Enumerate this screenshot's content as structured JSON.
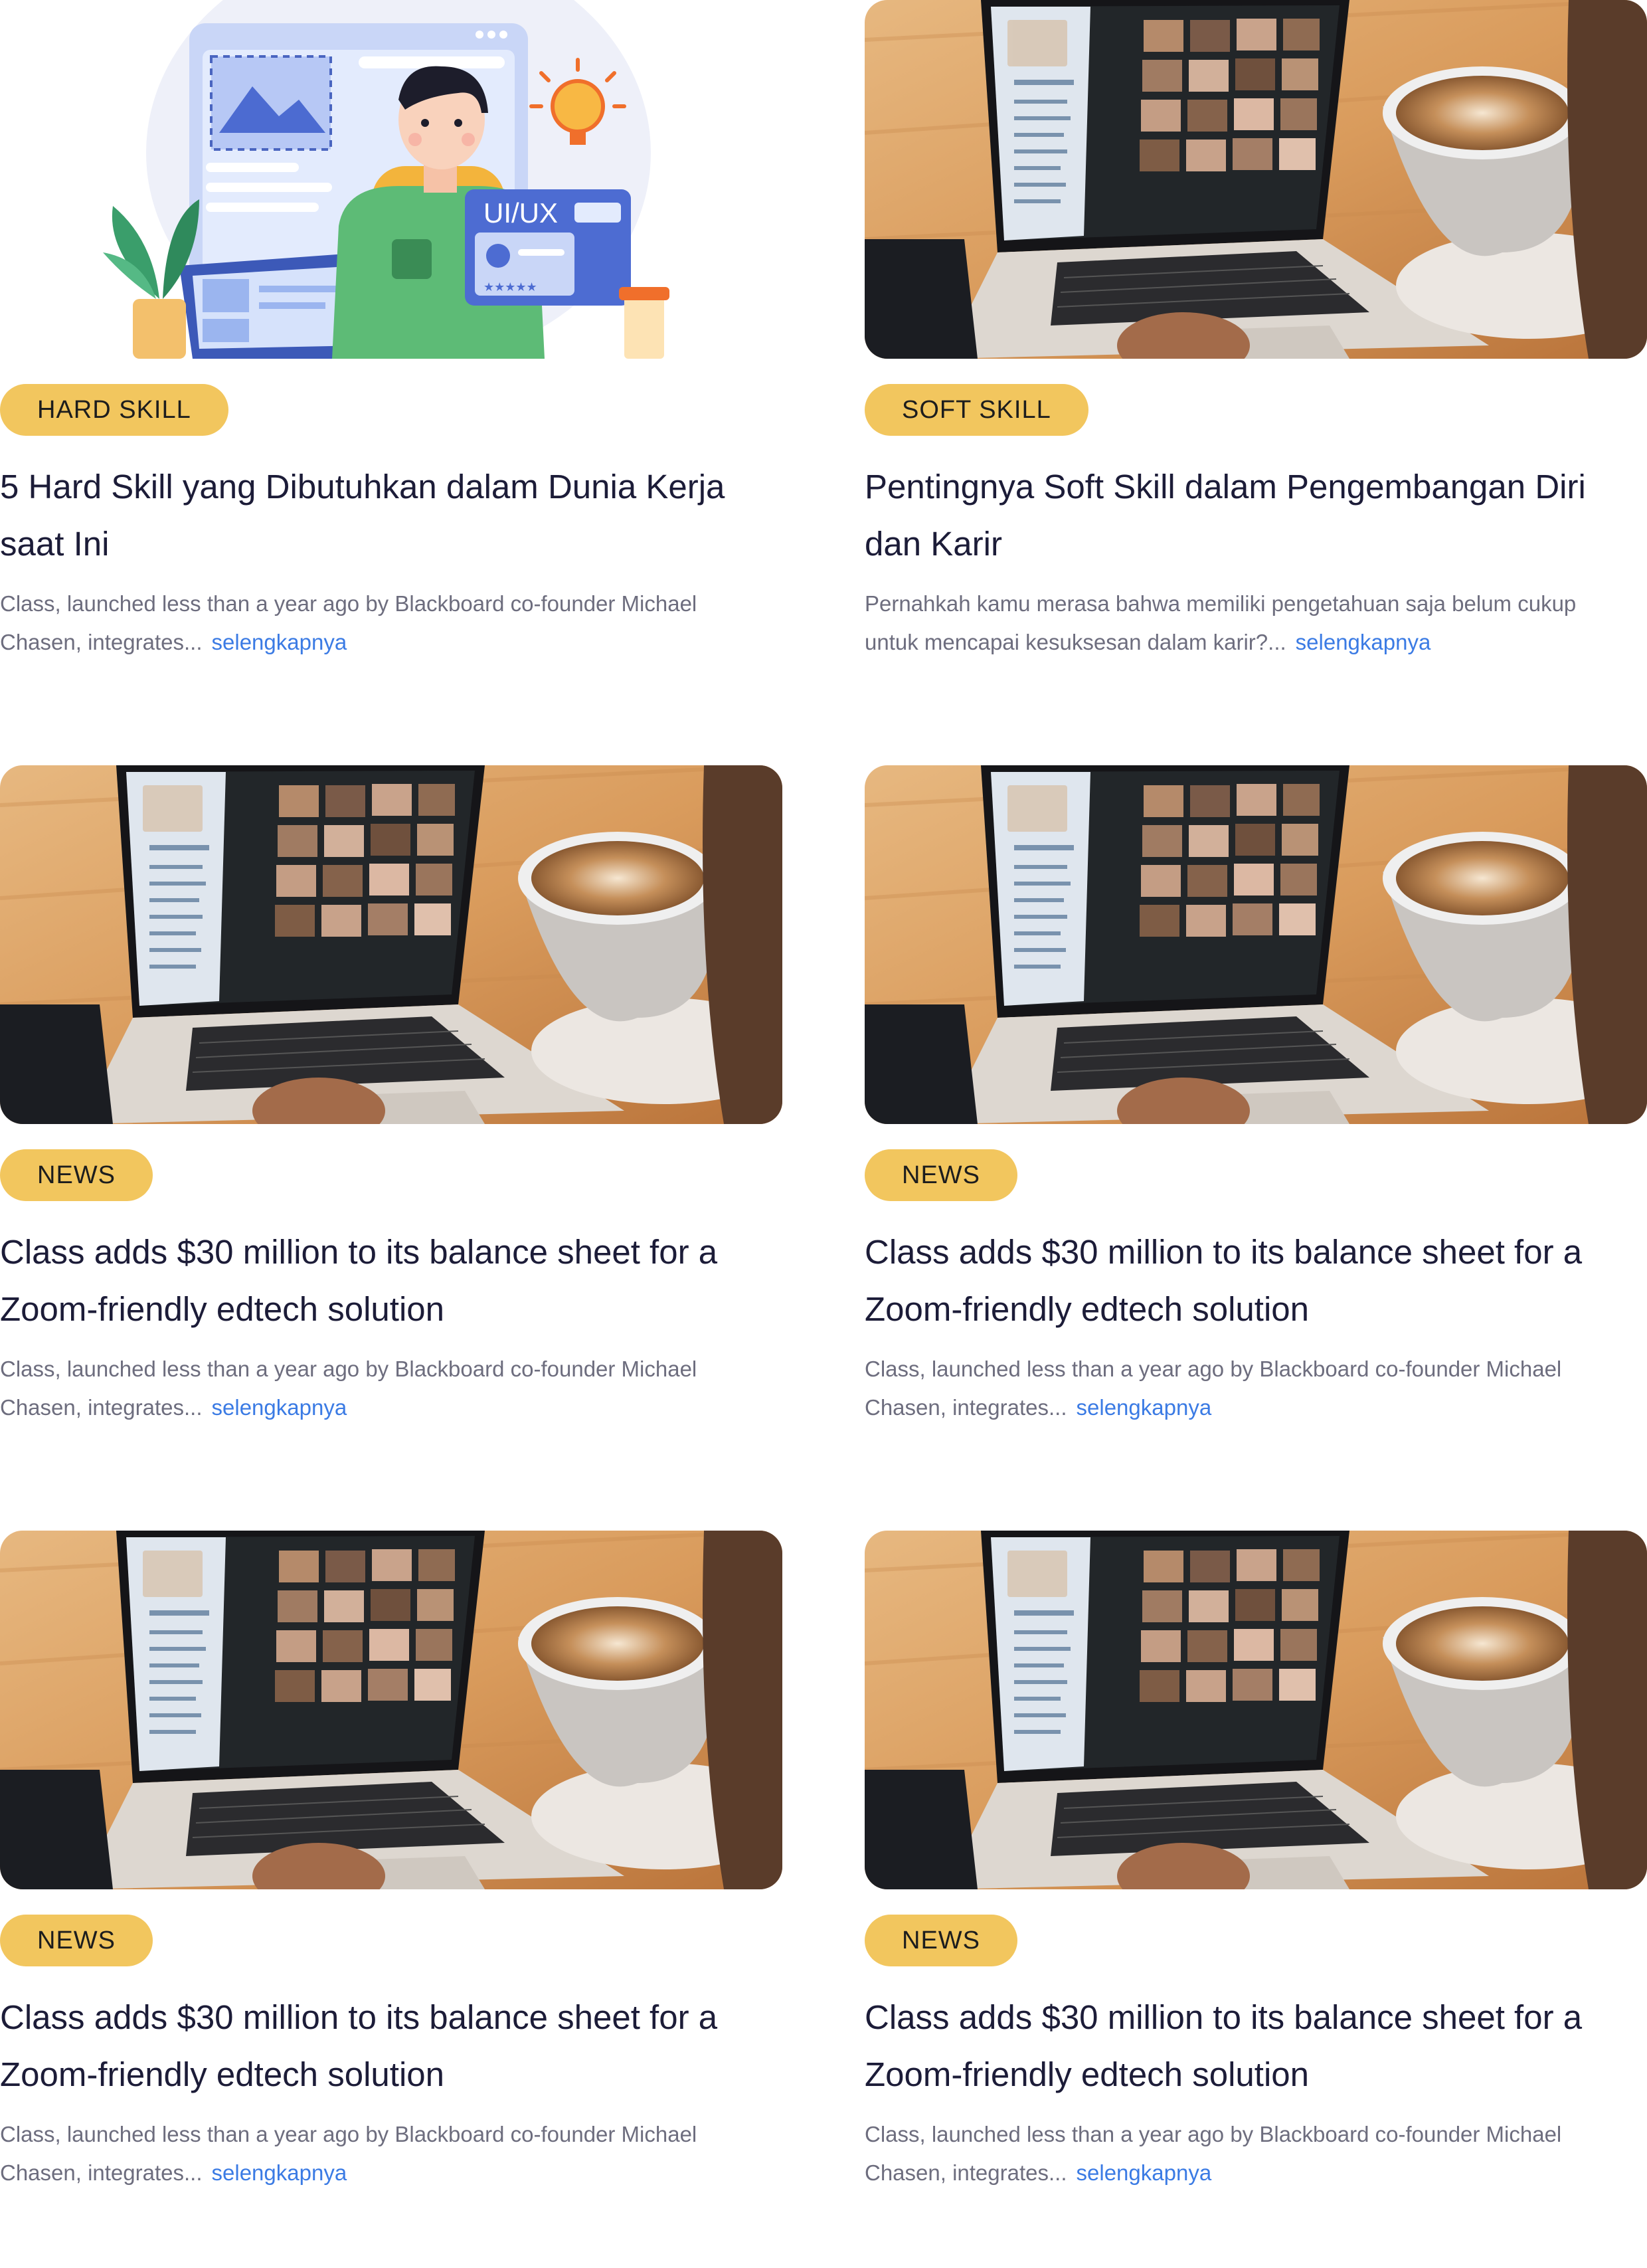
{
  "articles": [
    {
      "image": "illustration-uiux-designer",
      "category": "HARD SKILL",
      "title": "5 Hard Skill yang Dibutuhkan dalam Dunia Kerja saat Ini",
      "excerpt": "Class, launched less than a year ago by Blackboard co-founder Michael Chasen, integrates...",
      "read_more": "selengkapnya"
    },
    {
      "image": "photo-laptop-video-call",
      "category": "SOFT SKILL",
      "title": "Pentingnya Soft Skill dalam Pengembangan Diri dan Karir",
      "excerpt": "Pernahkah kamu merasa bahwa memiliki pengetahuan saja belum cukup untuk mencapai kesuksesan dalam karir?...",
      "read_more": "selengkapnya"
    },
    {
      "image": "photo-laptop-video-call",
      "category": "NEWS",
      "title": "Class adds $30 million to its balance sheet for a Zoom-friendly edtech solution",
      "excerpt": "Class, launched less than a year ago by Blackboard co-founder Michael Chasen, integrates...",
      "read_more": "selengkapnya"
    },
    {
      "image": "photo-laptop-video-call",
      "category": "NEWS",
      "title": "Class adds $30 million to its balance sheet for a Zoom-friendly edtech solution",
      "excerpt": "Class, launched less than a year ago by Blackboard co-founder Michael Chasen, integrates...",
      "read_more": "selengkapnya"
    },
    {
      "image": "photo-laptop-video-call",
      "category": "NEWS",
      "title": "Class adds $30 million to its balance sheet for a Zoom-friendly edtech solution",
      "excerpt": "Class, launched less than a year ago by Blackboard co-founder Michael Chasen, integrates...",
      "read_more": "selengkapnya"
    },
    {
      "image": "photo-laptop-video-call",
      "category": "NEWS",
      "title": "Class adds $30 million to its balance sheet for a Zoom-friendly edtech solution",
      "excerpt": "Class, launched less than a year ago by Blackboard co-founder Michael Chasen, integrates...",
      "read_more": "selengkapnya"
    }
  ],
  "illustration_labels": {
    "uiux": "UI/UX",
    "stars": "★★★★★"
  },
  "colors": {
    "badge": "#f2c65e",
    "link": "#3b7be4",
    "title": "#1c1c38",
    "excerpt": "#6d6d7e"
  }
}
